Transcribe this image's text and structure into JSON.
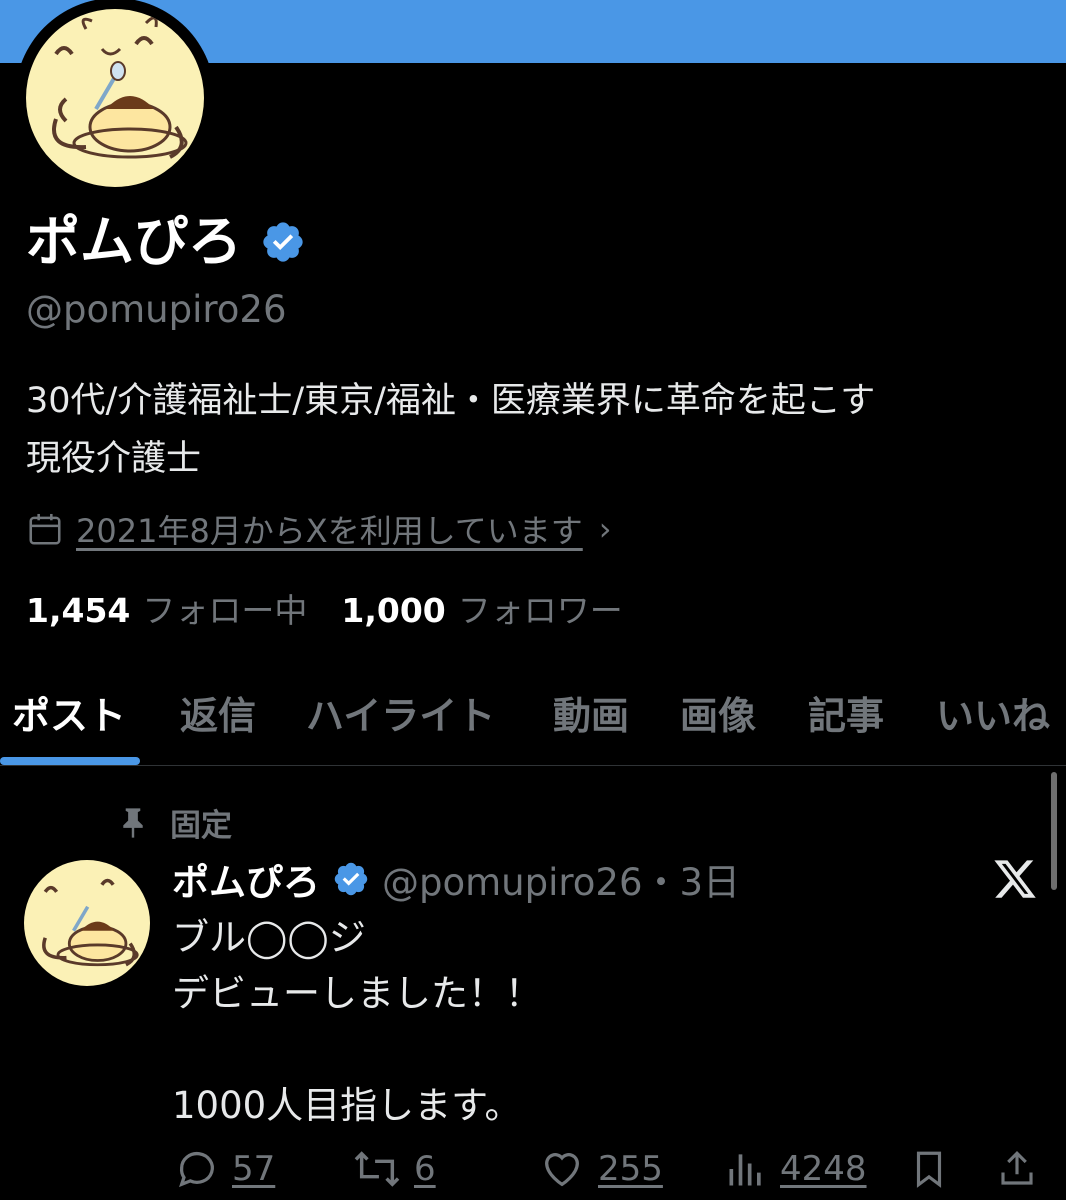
{
  "profile": {
    "display_name": "ポムぴろ",
    "handle": "@pomupiro26",
    "bio_line1": "30代/介護福祉士/東京/福祉・医療業界に革命を起こす",
    "bio_line2": "現役介護士",
    "joined": "2021年8月からXを利用しています",
    "following_count": "1,454",
    "following_label": "フォロー中",
    "followers_count": "1,000",
    "followers_label": "フォロワー"
  },
  "tabs": [
    {
      "label": "ポスト",
      "active": true
    },
    {
      "label": "返信",
      "active": false
    },
    {
      "label": "ハイライト",
      "active": false
    },
    {
      "label": "動画",
      "active": false
    },
    {
      "label": "画像",
      "active": false
    },
    {
      "label": "記事",
      "active": false
    },
    {
      "label": "いいね",
      "active": false
    }
  ],
  "pinned_post": {
    "pinned_label": "固定",
    "author_name": "ポムぴろ",
    "author_handle_time": "@pomupiro26・3日",
    "text": "ブル◯◯ジ\nデビューしました！！\n\n1000人目指します。",
    "replies": "57",
    "reposts": "6",
    "likes": "255",
    "views": "4248"
  },
  "colors": {
    "accent": "#4a97e6",
    "muted": "#71767b",
    "avatar_bg": "#fbf1b6"
  },
  "icons": [
    "calendar-icon",
    "chevron-right-icon",
    "verified-badge-icon",
    "pin-icon",
    "x-logo-icon",
    "reply-icon",
    "repost-icon",
    "like-icon",
    "views-icon",
    "bookmark-icon",
    "share-icon"
  ]
}
